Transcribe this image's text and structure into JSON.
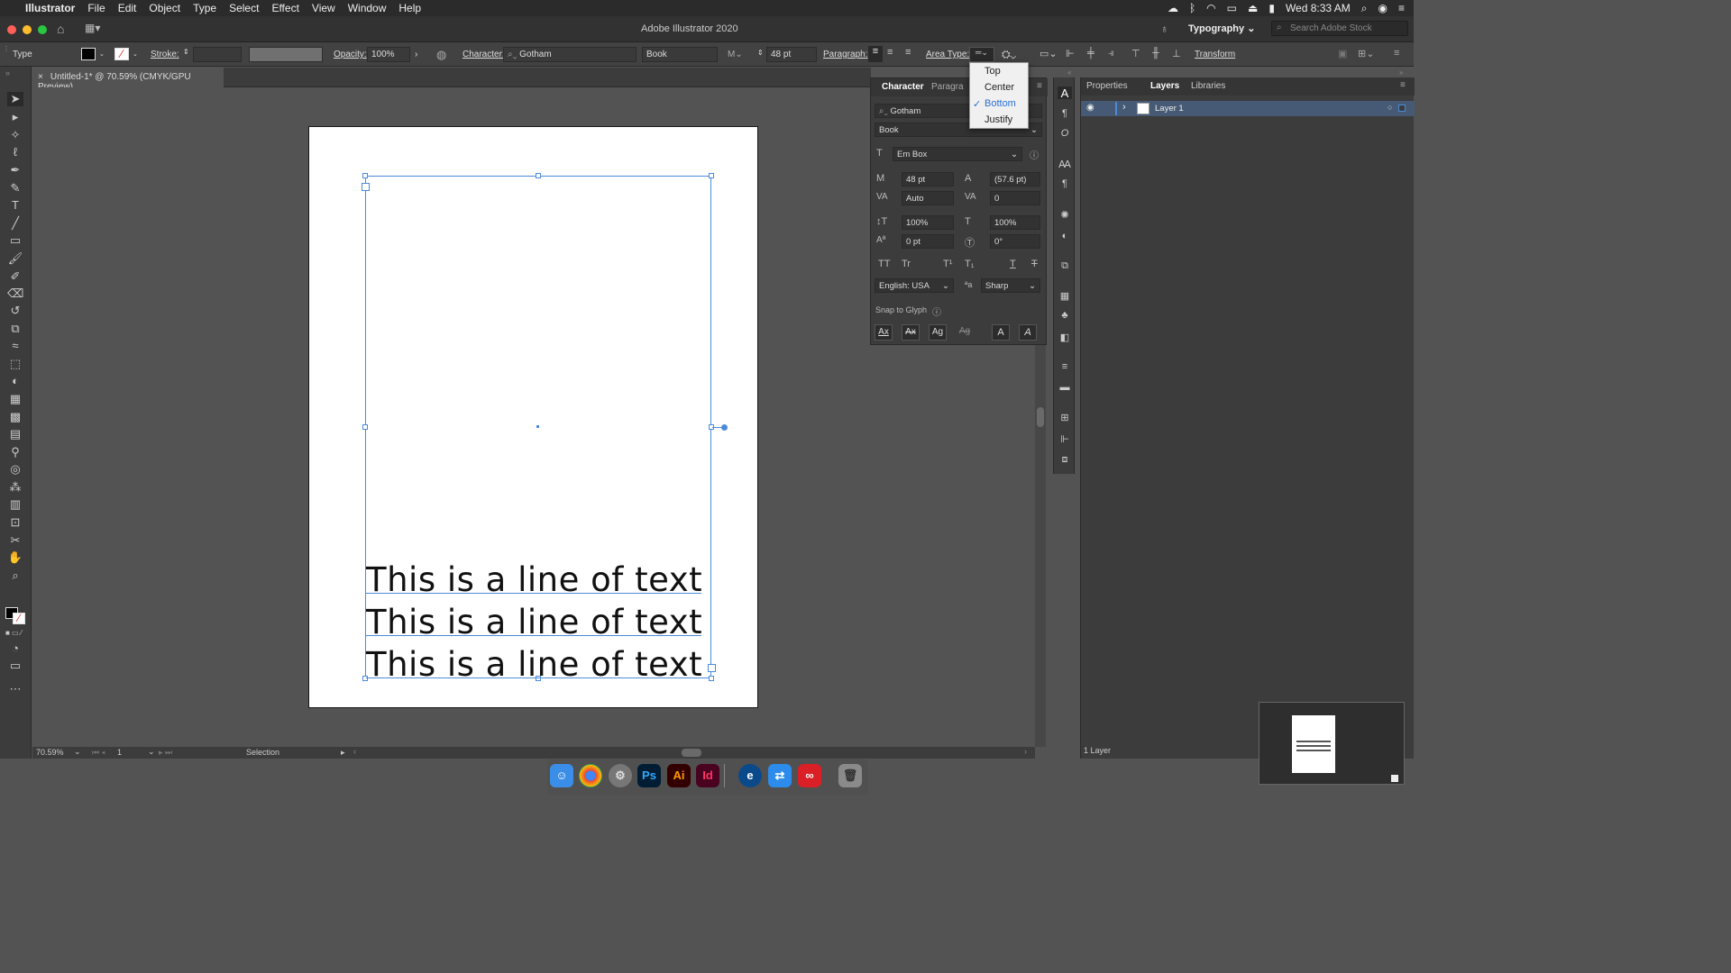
{
  "menubar": {
    "apple": "",
    "app": "Illustrator",
    "items": [
      "File",
      "Edit",
      "Object",
      "Type",
      "Select",
      "Effect",
      "View",
      "Window",
      "Help"
    ],
    "clock": "Wed 8:33 AM"
  },
  "window": {
    "title": "Adobe Illustrator 2020",
    "workspace": "Typography",
    "search_placeholder": "Search Adobe Stock"
  },
  "control": {
    "label_type": "Type",
    "stroke_label": "Stroke:",
    "opacity_label": "Opacity:",
    "opacity_value": "100%",
    "character_label": "Character:",
    "font": "Gotham",
    "style": "Book",
    "size": "48 pt",
    "paragraph_label": "Paragraph:",
    "area_type_label": "Area Type:",
    "transform": "Transform"
  },
  "document": {
    "tab": "Untitled-1* @ 70.59% (CMYK/GPU Preview)",
    "lines": [
      "This is a line of text",
      "This is a line of text",
      "This is a line of text"
    ]
  },
  "status": {
    "zoom": "70.59%",
    "artboard": "1",
    "tool": "Selection"
  },
  "char_panel": {
    "tab1": "Character",
    "tab2": "Paragra",
    "font": "Gotham",
    "style": "Book",
    "em_box": "Em Box",
    "size": "48 pt",
    "leading": "(57.6 pt)",
    "kerning": "Auto",
    "tracking": "0",
    "vscale": "100%",
    "hscale": "100%",
    "baseline": "0 pt",
    "rotation": "0°",
    "language": "English: USA",
    "aa": "Sharp",
    "snap": "Snap to Glyph",
    "sym_tt": "TT",
    "sym_tr": "Tr",
    "sym_sup": "T¹",
    "sym_sub": "T₁",
    "sym_u": "T",
    "sym_s": "T",
    "snap_a": "Ax",
    "snap_b": "Ax",
    "snap_c": "Ag",
    "snap_d": "Ag",
    "snap_e": "A",
    "snap_f": "A"
  },
  "area_type_menu": {
    "items": [
      "Top",
      "Center",
      "Bottom",
      "Justify"
    ],
    "selected": "Bottom"
  },
  "right_panel": {
    "tabs": [
      "Properties",
      "Layers",
      "Libraries"
    ],
    "active": "Layers",
    "layer": "Layer 1",
    "count": "1 Layer"
  },
  "dock": {
    "ps": "Ps",
    "ai": "Ai",
    "id": "Id"
  },
  "colors": {
    "selection": "#4a8bd9",
    "panel": "#3c3c3c",
    "canvas": "#535353"
  }
}
